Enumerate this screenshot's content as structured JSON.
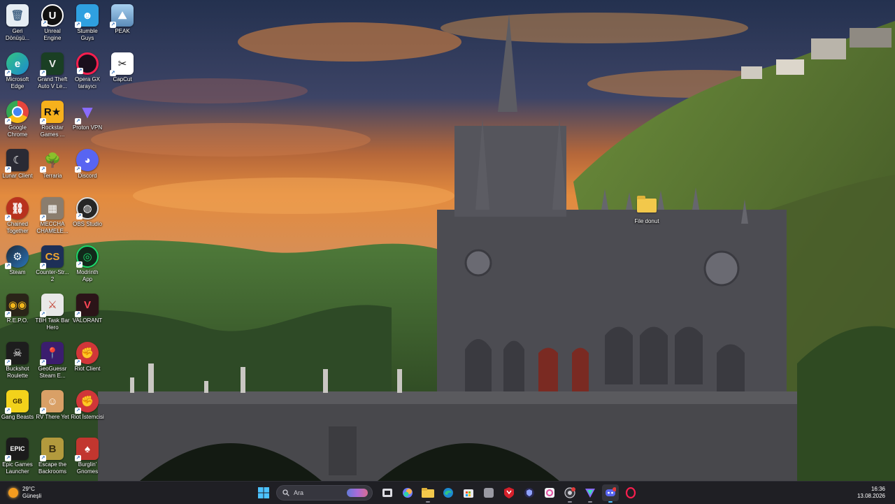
{
  "desktop": {
    "icons_col1": [
      {
        "label": "Geri\nDönüşü...",
        "icon": "recycle-bin-icon",
        "color": "#dfe6ee"
      },
      {
        "label": "Microsoft\nEdge",
        "icon": "edge-icon",
        "color": "#1c8ad1"
      },
      {
        "label": "Google\nChrome",
        "icon": "chrome-icon",
        "color": "#e8453c"
      },
      {
        "label": "Lunar Client",
        "icon": "lunar-client-icon",
        "color": "#2a2a34"
      },
      {
        "label": "Chained\nTogether",
        "icon": "chained-together-icon",
        "color": "#b8321e"
      },
      {
        "label": "Steam",
        "icon": "steam-icon",
        "color": "#17364f"
      },
      {
        "label": "R.E.P.O.",
        "icon": "repo-icon",
        "color": "#2a2418"
      },
      {
        "label": "Buckshot\nRoulette",
        "icon": "buckshot-icon",
        "color": "#1d1d1d"
      },
      {
        "label": "Gang Beasts",
        "icon": "gang-beasts-icon",
        "color": "#f2d21b"
      },
      {
        "label": "Epic Games\nLauncher",
        "icon": "epic-games-icon",
        "color": "#1b1b1b"
      }
    ],
    "icons_col2": [
      {
        "label": "Unreal\nEngine",
        "icon": "unreal-engine-icon",
        "color": "#111111"
      },
      {
        "label": "Grand Theft\nAuto V Le...",
        "icon": "gta-icon",
        "color": "#1a3f24"
      },
      {
        "label": "Rockstar\nGames ...",
        "icon": "rockstar-icon",
        "color": "#f7b11c"
      },
      {
        "label": "Terraria",
        "icon": "terraria-icon",
        "color": "#2d6f2c"
      },
      {
        "label": "MECCHA\nCHAMELE...",
        "icon": "meccha-icon",
        "color": "#8a7d6e"
      },
      {
        "label": "Counter-Str...\n2",
        "icon": "cs2-icon",
        "color": "#1d2f57"
      },
      {
        "label": "TBH Task Bar\nHero",
        "icon": "tbh-icon",
        "color": "#e8e8e8"
      },
      {
        "label": "GeoGuessr\nSteam E...",
        "icon": "geoguessr-icon",
        "color": "#3b1d6e"
      },
      {
        "label": "RV There Yet",
        "icon": "rv-there-yet-icon",
        "color": "#d9a066"
      },
      {
        "label": "Escape the\nBackrooms",
        "icon": "backrooms-icon",
        "color": "#b39a3d"
      }
    ],
    "icons_col3": [
      {
        "label": "Stumble\nGuys",
        "icon": "stumble-guys-icon",
        "color": "#2fa0e0"
      },
      {
        "label": "Opera GX\ntarayıcı",
        "icon": "opera-gx-icon",
        "color": "#1a0f1c"
      },
      {
        "label": "Proton VPN",
        "icon": "proton-vpn-icon",
        "color": "#6d4aff"
      },
      {
        "label": "Discord",
        "icon": "discord-icon",
        "color": "#5865f2"
      },
      {
        "label": "OBS Studio",
        "icon": "obs-studio-icon",
        "color": "#262626"
      },
      {
        "label": "Modrinth\nApp",
        "icon": "modrinth-icon",
        "color": "#12291b"
      },
      {
        "label": "VALORANT",
        "icon": "valorant-icon",
        "color": "#2b1418"
      },
      {
        "label": "Riot Client",
        "icon": "riot-client-icon",
        "color": "#d13639"
      },
      {
        "label": "Riot İstemcisi",
        "icon": "riot-client-icon",
        "color": "#d13639"
      },
      {
        "label": "Burglin'\nGnomes",
        "icon": "burglin-gnomes-icon",
        "color": "#c2362f"
      }
    ],
    "icons_col4": [
      {
        "label": "PEAK",
        "icon": "peak-icon",
        "color": "#7db0d8"
      },
      {
        "label": "CapCut",
        "icon": "capcut-icon",
        "color": "#ffffff"
      }
    ],
    "folder": {
      "label": "File donut",
      "icon": "folder-icon"
    }
  },
  "taskbar": {
    "weather": {
      "temp": "29°C",
      "condition": "Güneşli",
      "icon": "sun-icon"
    },
    "search_placeholder": "Ara",
    "apps": [
      {
        "name": "task-view",
        "icon": "task-view-icon"
      },
      {
        "name": "copilot",
        "icon": "copilot-icon"
      },
      {
        "name": "file-explorer",
        "icon": "folder-icon"
      },
      {
        "name": "edge",
        "icon": "edge-icon"
      },
      {
        "name": "store",
        "icon": "store-icon"
      },
      {
        "name": "app-gray",
        "icon": "app-icon"
      },
      {
        "name": "mcafee",
        "icon": "shield-icon"
      },
      {
        "name": "proton-vpn-shield",
        "icon": "vpn-icon"
      },
      {
        "name": "mail",
        "icon": "mail-icon"
      },
      {
        "name": "chrome-like",
        "icon": "browser-icon"
      },
      {
        "name": "proton-vpn",
        "icon": "proton-vpn-icon"
      },
      {
        "name": "discord",
        "icon": "discord-icon"
      },
      {
        "name": "opera-gx",
        "icon": "opera-gx-icon"
      }
    ],
    "clock": {
      "time": "16:36",
      "date": "13.08.2026"
    }
  },
  "colors": {
    "taskbar_bg": "#1f1f24",
    "accent": "#4cc2ff"
  }
}
